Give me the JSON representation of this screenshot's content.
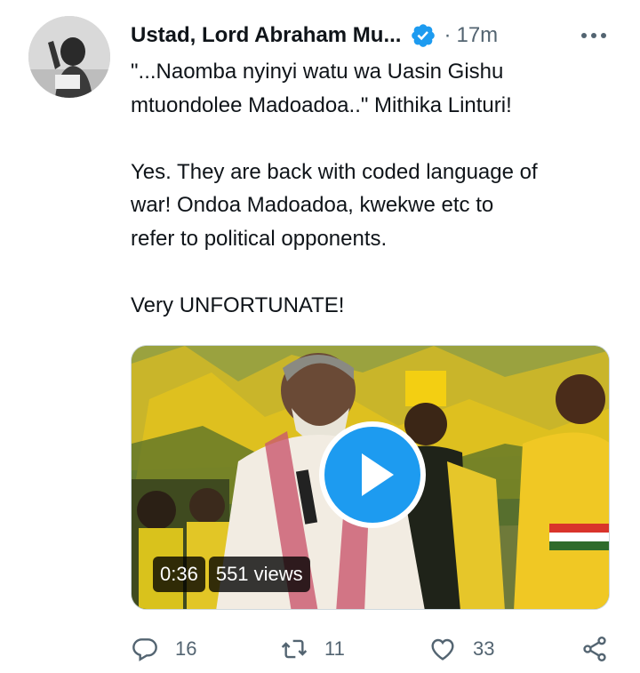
{
  "tweet": {
    "author_name": "Ustad, Lord Abraham Mu...",
    "separator": "·",
    "time": "17m",
    "text_lines": [
      "\"...Naomba nyinyi watu wa Uasin Gishu",
      "mtuondolee Madoadoa..\" Mithika Linturi!",
      "Yes. They are back with coded language of",
      "war! Ondoa Madoadoa, kwekwe etc to",
      "refer to political opponents.",
      "Very UNFORTUNATE!"
    ]
  },
  "video": {
    "duration": "0:36",
    "views": "551 views"
  },
  "actions": {
    "replies": "16",
    "retweets": "11",
    "likes": "33"
  },
  "colors": {
    "verified": "#1d9bf0",
    "play_button": "#1d9bf0",
    "muted_text": "#536471"
  },
  "icons": [
    "verified-badge-icon",
    "more-options-icon",
    "play-icon",
    "reply-icon",
    "retweet-icon",
    "like-icon",
    "share-icon"
  ]
}
